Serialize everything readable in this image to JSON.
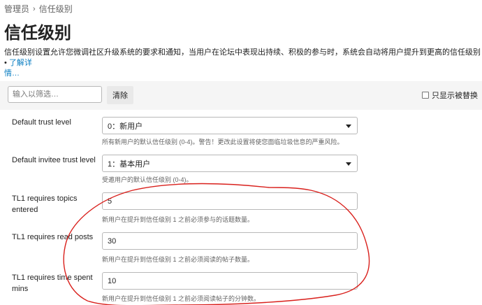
{
  "breadcrumb": {
    "parent": "管理员",
    "current": "信任级别"
  },
  "page_title": "信任级别",
  "description": {
    "text": "信任级别设置允许您微调社区升级系统的要求和通知，当用户在论坛中表现出持续、积极的参与时，系统会自动将用户提升到更高的信任级别 •",
    "link_line1": "了解详",
    "link_line2": "情…"
  },
  "filter": {
    "placeholder": "输入以筛选…",
    "clear_label": "清除",
    "only_overridden_label": "只显示被替换"
  },
  "settings": [
    {
      "label": "Default trust level",
      "value": "0：新用户",
      "help": "所有新用户的默认信任级别 (0-4)。警告！更改此设置将使您面临垃圾信息的严重风险。"
    },
    {
      "label": "Default invitee trust level",
      "value": "1：基本用户",
      "help": "受邀用户的默认信任级别 (0-4)。"
    },
    {
      "label": "TL1 requires topics entered",
      "value": "5",
      "help": "新用户在提升到信任级别 1 之前必须参与的话题数量。"
    },
    {
      "label": "TL1 requires read posts",
      "value": "30",
      "help": "新用户在提升到信任级别 1 之前必须阅读的帖子数量。"
    },
    {
      "label": "TL1 requires time spent mins",
      "value": "10",
      "help": "新用户在提升到信任级别 1 之前必须阅读帖子的分钟数。"
    }
  ],
  "colors": {
    "link": "#0a7ec2",
    "annotation": "#d9201c",
    "filter_bar": "#f5f5f5"
  }
}
